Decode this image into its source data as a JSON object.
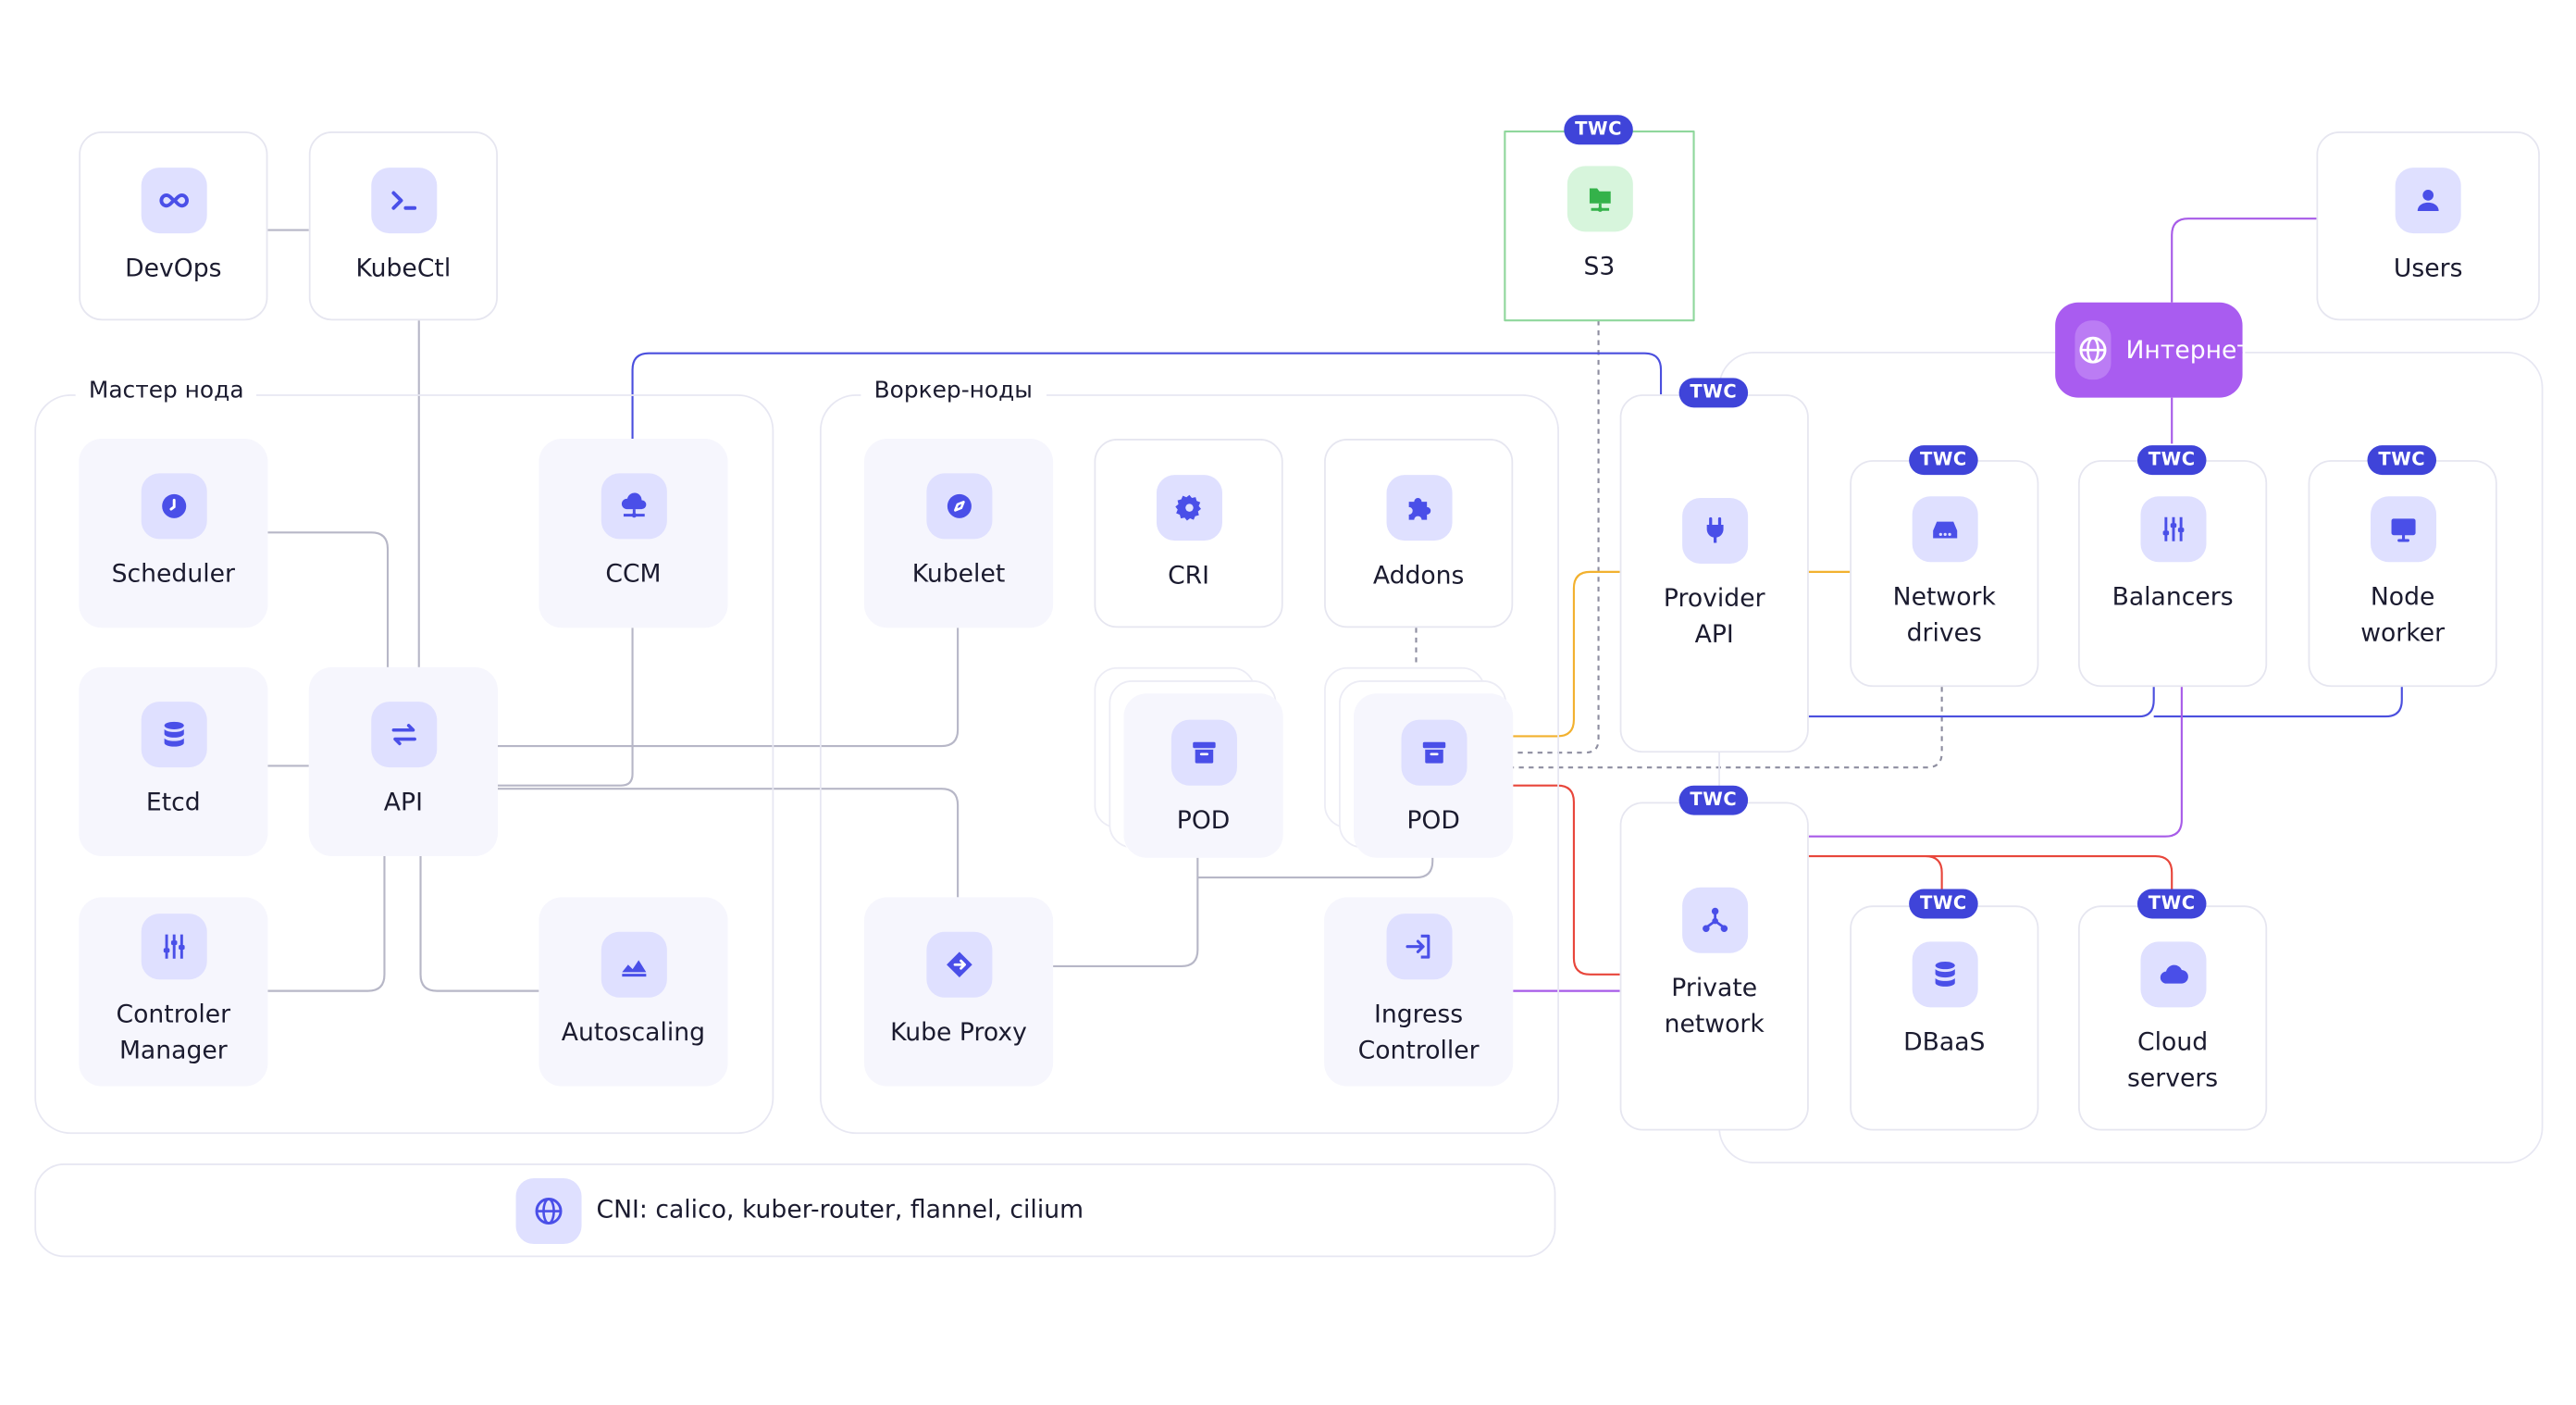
{
  "groups": {
    "master_label": "Мастер нода",
    "worker_label": "Воркер-ноды"
  },
  "badge_text": "TWC",
  "internet_label": "Интернет",
  "cni_label": "CNI: calico, kuber-router, flannel, cilium",
  "nodes": {
    "devops": "DevOps",
    "kubectl": "KubeCtl",
    "s3": "S3",
    "users": "Users",
    "scheduler": "Scheduler",
    "ccm": "CCM",
    "etcd": "Etcd",
    "api": "API",
    "controller_manager": "Controler\nManager",
    "autoscaling": "Autoscaling",
    "kubelet": "Kubelet",
    "cri": "CRI",
    "addons": "Addons",
    "pod1": "POD",
    "pod2": "POD",
    "kube_proxy": "Kube Proxy",
    "ingress_controller": "Ingress\nController",
    "provider_api": "Provider\nAPI",
    "network_drives": "Network\ndrives",
    "balancers": "Balancers",
    "node_worker": "Node\nworker",
    "private_network": "Private\nnetwork",
    "dbaas": "DBaaS",
    "cloud_servers": "Cloud\nservers"
  },
  "colors": {
    "icon": "#4a4fe8",
    "icon_bg": "#dfe0ff",
    "badge": "#3f44d9",
    "internet": "#a95cf0",
    "s3_icon": "#34b24a",
    "s3_icon_bg": "#d7f5dc",
    "link_gray": "#b7b7c7",
    "link_blue": "#4b4fde",
    "link_purple": "#a75be8",
    "link_orange": "#f2b12f",
    "link_red": "#e8463b",
    "link_s3": "#8fd79c"
  }
}
